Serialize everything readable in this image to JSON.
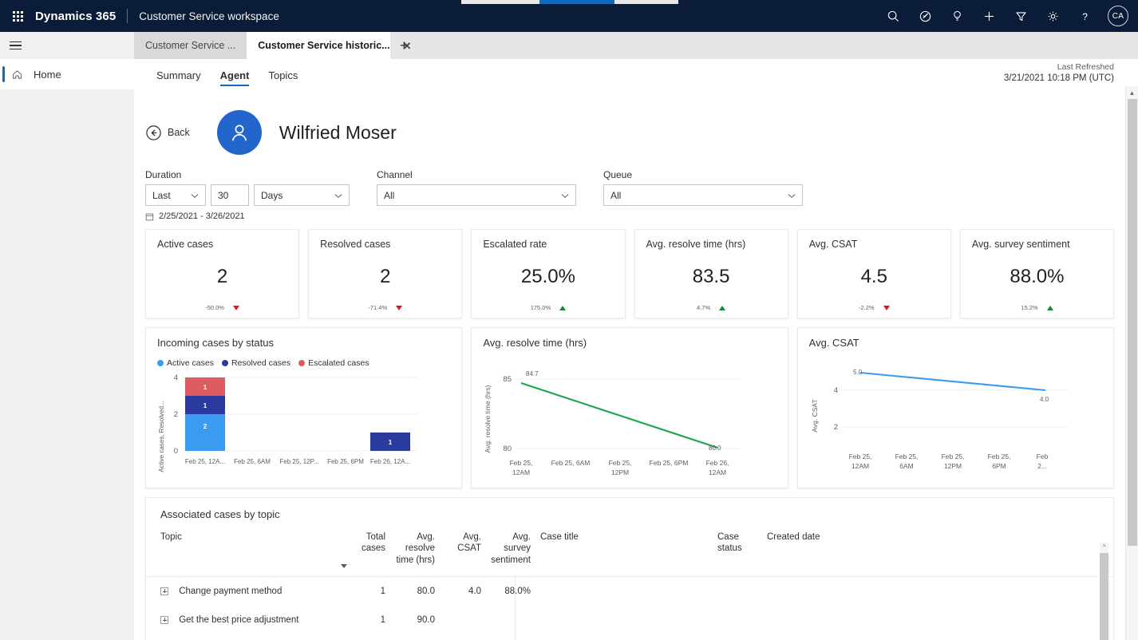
{
  "header": {
    "waffle_label": "app-launcher",
    "brand": "Dynamics 365",
    "app_name": "Customer Service workspace",
    "avatar_initials": "CA",
    "icons": [
      "search-icon",
      "relationship-assistant-icon",
      "lightbulb-icon",
      "plus-icon",
      "filter-icon",
      "gear-icon",
      "help-icon"
    ]
  },
  "tabstrip": {
    "tabs": [
      {
        "label": "Customer Service ...",
        "active": false
      },
      {
        "label": "Customer Service historic...",
        "active": true
      }
    ],
    "close_glyph": "✕",
    "add_glyph": "+"
  },
  "sidebar": {
    "items": [
      {
        "label": "Home",
        "icon": "home-icon",
        "selected": true
      }
    ]
  },
  "dashboard": {
    "tabs": [
      {
        "label": "Summary",
        "active": false
      },
      {
        "label": "Agent",
        "active": true
      },
      {
        "label": "Topics",
        "active": false
      }
    ],
    "refresh_label": "Last Refreshed",
    "refresh_value": "3/21/2021 10:18 PM (UTC)"
  },
  "profile": {
    "back_label": "Back",
    "name": "Wilfried Moser",
    "avatar_color": "#2266cc"
  },
  "filters": {
    "duration": {
      "label": "Duration",
      "relative": "Last",
      "amount": "30",
      "unit": "Days",
      "range_text": "2/25/2021 - 3/26/2021"
    },
    "channel": {
      "label": "Channel",
      "value": "All"
    },
    "queue": {
      "label": "Queue",
      "value": "All"
    }
  },
  "kpis": [
    {
      "title": "Active cases",
      "value": "2",
      "delta": "-50.0%",
      "direction": "down"
    },
    {
      "title": "Resolved cases",
      "value": "2",
      "delta": "-71.4%",
      "direction": "down"
    },
    {
      "title": "Escalated rate",
      "value": "25.0%",
      "delta": "175.0%",
      "direction": "up"
    },
    {
      "title": "Avg. resolve time (hrs)",
      "value": "83.5",
      "delta": "4.7%",
      "direction": "up"
    },
    {
      "title": "Avg. CSAT",
      "value": "4.5",
      "delta": "-2.2%",
      "direction": "down"
    },
    {
      "title": "Avg. survey sentiment",
      "value": "88.0%",
      "delta": "15.2%",
      "direction": "up"
    }
  ],
  "colors": {
    "active_cases": "#3b9bf0",
    "resolved_cases": "#2b3a9e",
    "escalated_cases": "#dd5c61",
    "resolve_time_line": "#1eA546",
    "csat_line": "#3b9bf0",
    "accent": "#0f6cbd",
    "up": "#10893e",
    "down": "#e81123"
  },
  "chart_data": [
    {
      "type": "bar",
      "title": "Incoming cases by status",
      "stacked": true,
      "xlabel": "",
      "ylabel": "Active cases, Resolved...",
      "ylim": [
        0,
        4
      ],
      "yticks": [
        0,
        2,
        4
      ],
      "grid": true,
      "legend": [
        "Active cases",
        "Resolved cases",
        "Escalated cases"
      ],
      "legend_position": "top-left",
      "categories": [
        "Feb 25, 12A...",
        "Feb 25, 6AM",
        "Feb 25, 12P...",
        "Feb 25, 6PM",
        "Feb 26, 12A..."
      ],
      "series": [
        {
          "name": "Active cases",
          "color": "#3b9bf0",
          "values": [
            2,
            0,
            0,
            0,
            0
          ]
        },
        {
          "name": "Resolved cases",
          "color": "#2b3a9e",
          "values": [
            1,
            0,
            0,
            0,
            1
          ]
        },
        {
          "name": "Escalated cases",
          "color": "#dd5c61",
          "values": [
            1,
            0,
            0,
            0,
            0
          ]
        }
      ],
      "bar_labels": [
        {
          "category": "Feb 25, 12A...",
          "series": "Escalated cases",
          "label": "1"
        },
        {
          "category": "Feb 25, 12A...",
          "series": "Resolved cases",
          "label": "1"
        },
        {
          "category": "Feb 25, 12A...",
          "series": "Active cases",
          "label": "2"
        },
        {
          "category": "Feb 26, 12A...",
          "series": "Resolved cases",
          "label": "1"
        }
      ]
    },
    {
      "type": "line",
      "title": "Avg. resolve time (hrs)",
      "xlabel": "",
      "ylabel": "Avg. resolve time (hrs)",
      "ylim": [
        80,
        85
      ],
      "yticks": [
        80,
        85
      ],
      "grid": true,
      "legend": [],
      "categories": [
        "Feb 25, 12AM",
        "Feb 25, 6AM",
        "Feb 25, 12PM",
        "Feb 25, 6PM",
        "Feb 26, 12AM"
      ],
      "series": [
        {
          "name": "Avg. resolve time (hrs)",
          "color": "#1eA546",
          "values": [
            84.7,
            null,
            null,
            null,
            80.0
          ]
        }
      ],
      "point_labels": [
        {
          "x": "Feb 25, 12AM",
          "label": "84.7"
        },
        {
          "x": "Feb 26, 12AM",
          "label": "80.0"
        }
      ]
    },
    {
      "type": "line",
      "title": "Avg. CSAT",
      "xlabel": "",
      "ylabel": "Avg. CSAT",
      "ylim": [
        0,
        5
      ],
      "yticks": [
        2,
        4
      ],
      "grid": true,
      "legend": [],
      "categories": [
        "Feb 25, 12AM",
        "Feb 25, 6AM",
        "Feb 25, 12PM",
        "Feb 25, 6PM",
        "Feb 2..."
      ],
      "series": [
        {
          "name": "Avg. CSAT",
          "color": "#3b9bf0",
          "values": [
            5.0,
            null,
            null,
            null,
            4.0
          ]
        }
      ],
      "point_labels": [
        {
          "x": "Feb 25, 12AM",
          "label": "5.0"
        },
        {
          "x": "Feb 2...",
          "label": "4.0"
        }
      ]
    }
  ],
  "table": {
    "title": "Associated cases by topic",
    "sorted_column": "Total cases",
    "sort_direction": "desc",
    "columns": [
      "Topic",
      "Total cases",
      "Avg. resolve time (hrs)",
      "Avg. CSAT",
      "Avg. survey sentiment",
      "Case title",
      "Case status",
      "Created date"
    ],
    "rows": [
      {
        "topic": "Change payment method",
        "total_cases": "1",
        "avg_resolve_time": "80.0",
        "avg_csat": "4.0",
        "avg_survey_sentiment": "88.0%",
        "case_title": "",
        "case_status": "",
        "created_date": ""
      },
      {
        "topic": "Get the best price adjustment",
        "total_cases": "1",
        "avg_resolve_time": "90.0",
        "avg_csat": "",
        "avg_survey_sentiment": "",
        "case_title": "",
        "case_status": "",
        "created_date": ""
      }
    ]
  }
}
